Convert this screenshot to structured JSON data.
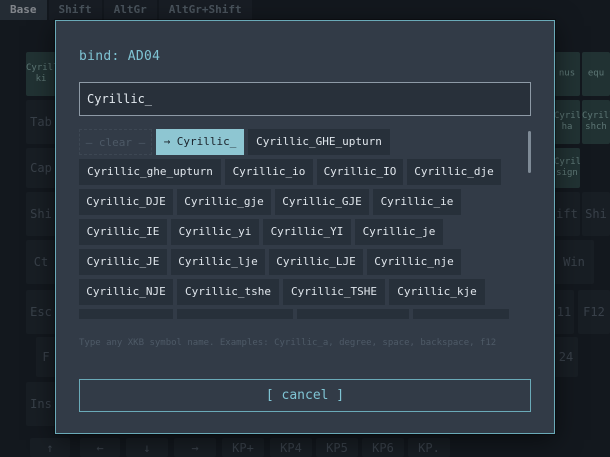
{
  "tabs": [
    "Base",
    "Shift",
    "AltGr",
    "AltGr+Shift"
  ],
  "background_keys": {
    "tab": "Tab",
    "caps": "Cap",
    "shift_left": "Shi",
    "ctrl": "Ct",
    "esc": "Esc",
    "f_left": "F",
    "ins": "Ins",
    "arrow_up": "↑",
    "arrow_left": "←",
    "arrow_down": "↓",
    "arrow_right": "→",
    "kp_plus": "KP+",
    "kp4": "KP4",
    "kp5": "KP5",
    "kp6": "KP6",
    "kp_dot": "KP.",
    "minus": "nus",
    "equal": "equ",
    "cyr_left": "Cyrill\nki",
    "cyr_r1": "Cyrillic\nha",
    "cyr_r1b": "Cyrill\nshch",
    "cyr_r2": "Cyrilli\nsign",
    "shift_r1": "ift",
    "shift_r2": "Shi",
    "win": "Win",
    "f12": "F12",
    "f11": "11",
    "f24": "24"
  },
  "dialog": {
    "title": "bind: AD04",
    "search_value": "Cyrillic_",
    "clear_label": "— clear —",
    "selected_label": "→ Cyrillic_",
    "symbols": [
      [
        "Cyrillic_GHE_upturn"
      ],
      [
        "Cyrillic_ghe_upturn",
        "Cyrillic_io",
        "Cyrillic_IO",
        "Cyrillic_dje"
      ],
      [
        "Cyrillic_DJE",
        "Cyrillic_gje",
        "Cyrillic_GJE",
        "Cyrillic_ie"
      ],
      [
        "Cyrillic_IE",
        "Cyrillic_yi",
        "Cyrillic_YI",
        "Cyrillic_je"
      ],
      [
        "Cyrillic_JE",
        "Cyrillic_lje",
        "Cyrillic_LJE",
        "Cyrillic_nje"
      ],
      [
        "Cyrillic_NJE",
        "Cyrillic_tshe",
        "Cyrillic_TSHE",
        "Cyrillic_kje"
      ]
    ],
    "hint": "Type any XKB symbol name. Examples: Cyrillic_a, degree, space, backspace, f12",
    "cancel_label": "[ cancel ]"
  },
  "colors": {
    "accent": "#7fc4d4",
    "selected_chip": "#8ec6d2",
    "dialog_bg": "#323b47",
    "key_mapped": "#34514f"
  }
}
